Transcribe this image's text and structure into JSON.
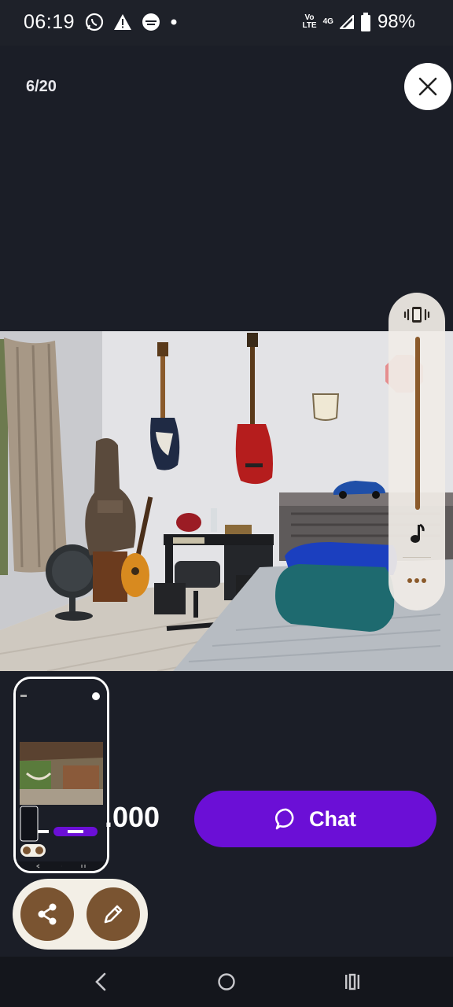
{
  "status": {
    "time": "06:19",
    "network_top": "Vo",
    "network_bottom": "LTE",
    "network_gen": "4G",
    "battery": "98%"
  },
  "viewer": {
    "counter": "6/20",
    "close_icon": "close-icon"
  },
  "volume": {
    "mode_icon": "vibrate-icon",
    "media_icon": "music-note-icon",
    "more_icon": "more-dots-icon",
    "level": 1.0
  },
  "listing": {
    "price_partial": ".000",
    "chat_label": "Chat"
  },
  "actions": {
    "share_icon": "share-icon",
    "edit_icon": "edit-pencil-icon"
  },
  "nav": {
    "back_icon": "back-icon",
    "home_icon": "home-icon",
    "recents_icon": "recents-icon"
  },
  "colors": {
    "background": "#1b1e27",
    "accent": "#6b0fd6",
    "fab": "#7a5431",
    "fab_container": "#f3efe6",
    "volume_track": "#8b5a2b"
  }
}
